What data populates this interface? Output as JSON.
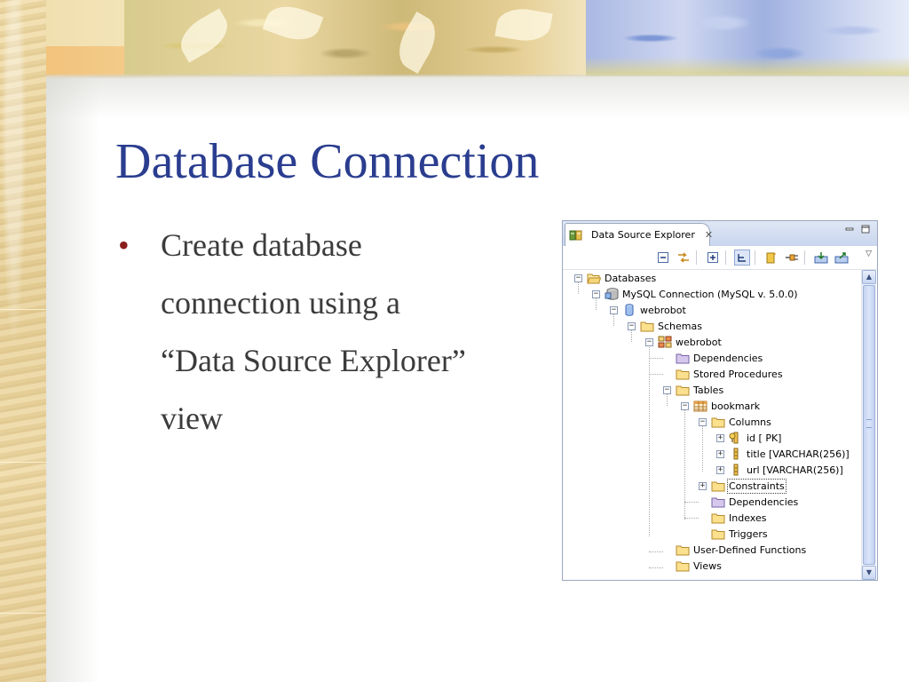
{
  "slide": {
    "title": "Database Connection",
    "bullet_lines": [
      "Create database",
      "connection using a",
      "“Data Source Explorer”",
      "view"
    ]
  },
  "view": {
    "tab_label": "Data Source Explorer",
    "colors": {
      "title": "#2a3d8f",
      "body_text": "#3b3b3b",
      "bullet": "#8b1d1d",
      "frame": "#9aa7bf"
    }
  },
  "toolbar": {
    "buttons": [
      "collapse-all-icon",
      "link-with-editor-icon",
      "expand-all-icon",
      "hierarchy-view-icon",
      "new-connection-icon",
      "connect-icon",
      "import-icon",
      "export-icon",
      "view-menu-icon"
    ]
  },
  "tree": {
    "databases": "Databases",
    "mysql_connection": "MySQL Connection (MySQL v. 5.0.0)",
    "webrobot_db": "webrobot",
    "schemas": "Schemas",
    "webrobot_schema": "webrobot",
    "dependencies_1": "Dependencies",
    "stored_procedures": "Stored Procedures",
    "tables": "Tables",
    "bookmark": "bookmark",
    "columns": "Columns",
    "col_id": "id [ PK]",
    "col_title": "title [VARCHAR(256)]",
    "col_url": "url [VARCHAR(256)]",
    "constraints": "Constraints",
    "dependencies_2": "Dependencies",
    "indexes": "Indexes",
    "triggers": "Triggers",
    "udf": "User-Defined Functions",
    "views": "Views"
  }
}
